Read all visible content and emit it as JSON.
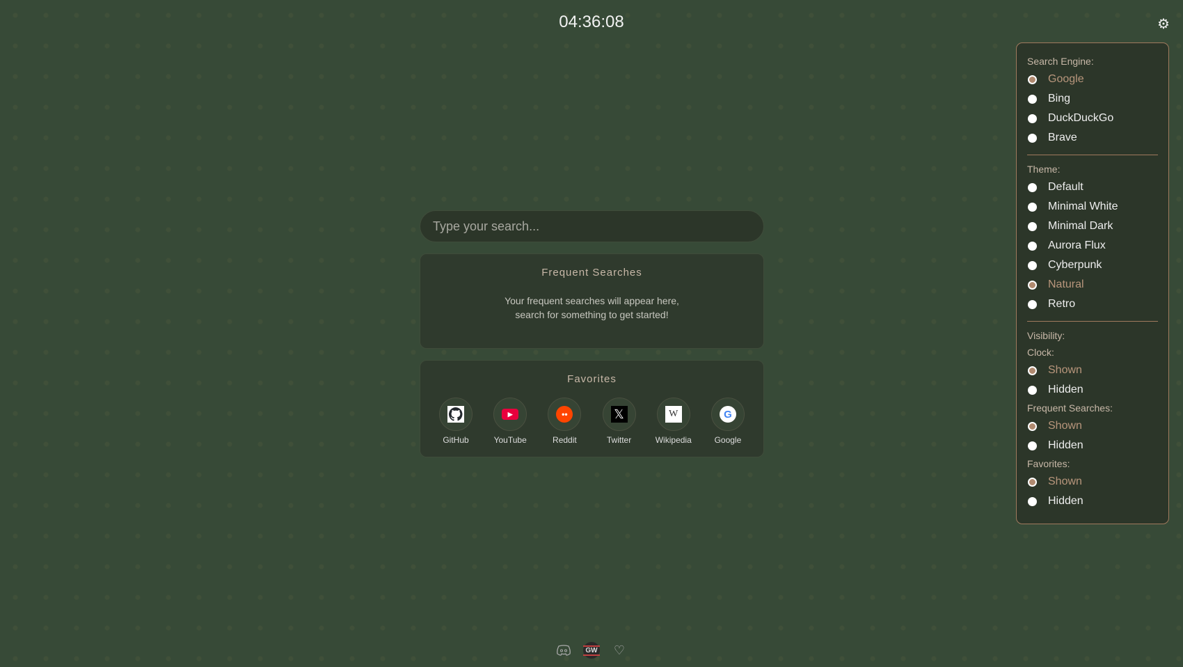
{
  "clock": "04:36:08",
  "search": {
    "placeholder": "Type your search..."
  },
  "frequent": {
    "title": "Frequent Searches",
    "line1": "Your frequent searches will appear here,",
    "line2": "search for something to get started!"
  },
  "favorites": {
    "title": "Favorites",
    "items": [
      {
        "label": "GitHub",
        "icon": "github-icon"
      },
      {
        "label": "YouTube",
        "icon": "youtube-icon"
      },
      {
        "label": "Reddit",
        "icon": "reddit-icon"
      },
      {
        "label": "Twitter",
        "icon": "x-icon"
      },
      {
        "label": "Wikipedia",
        "icon": "wikipedia-icon"
      },
      {
        "label": "Google",
        "icon": "google-icon"
      }
    ]
  },
  "settings": {
    "engine_label": "Search Engine:",
    "engines": [
      "Google",
      "Bing",
      "DuckDuckGo",
      "Brave"
    ],
    "engine_selected": "Google",
    "theme_label": "Theme:",
    "themes": [
      "Default",
      "Minimal White",
      "Minimal Dark",
      "Aurora Flux",
      "Cyberpunk",
      "Natural",
      "Retro"
    ],
    "theme_selected": "Natural",
    "visibility_label": "Visibility:",
    "clock_label": "Clock:",
    "frequent_label": "Frequent Searches:",
    "favorites_label": "Favorites:",
    "shown": "Shown",
    "hidden": "Hidden"
  },
  "colors": {
    "background": "#374a37",
    "panel": "#2c3629",
    "accent": "#b08a70"
  },
  "footer": {
    "icons": [
      "discord-icon",
      "logo-icon",
      "heart-icon"
    ]
  }
}
